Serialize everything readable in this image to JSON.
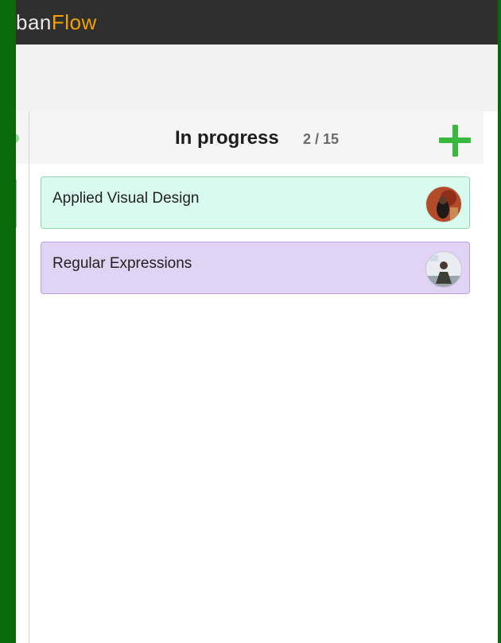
{
  "brand": {
    "part1": "ban",
    "part2": "Flow"
  },
  "column": {
    "title": "In progress",
    "count": "2 / 15"
  },
  "cards": [
    {
      "label": "Applied Visual Design",
      "color": "#d9fbef"
    },
    {
      "label": "Regular Expressions",
      "color": "#e0d3f3"
    }
  ],
  "colors": {
    "accent": "#f2a100",
    "add": "#38b83c",
    "frame": "#0a6a0a"
  }
}
